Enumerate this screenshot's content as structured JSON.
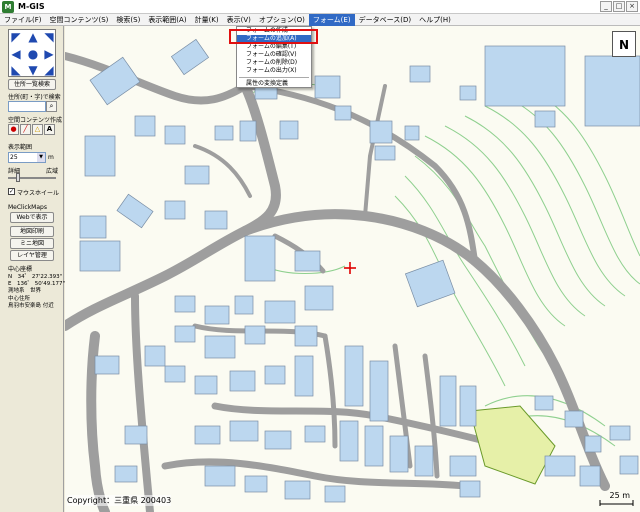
{
  "window": {
    "title": "M-GIS",
    "icon_letter": "M"
  },
  "menu": [
    "ファイル(F)",
    "空間コンテンツ(S)",
    "検索(S)",
    "表示範囲(A)",
    "計量(K)",
    "表示(V)",
    "オプション(O)",
    "フォーム(E)",
    "データベース(D)",
    "ヘルプ(H)"
  ],
  "dropdown": {
    "items": [
      "フォームの作成",
      "フォームの追加(A)",
      "フォームの編集(T)",
      "フォームの確認(V)",
      "フォームの削除(D)",
      "フォームの出力(X)"
    ],
    "extra": "属性の変換定義",
    "highlighted_index": 1
  },
  "panel": {
    "address_list_button": "住所一覧検索",
    "address_search_label": "住所(町・字)で検索",
    "spatial_create_label": "空間コンテンツ作成",
    "range_label": "表示範囲",
    "range_value": "25",
    "range_unit": "m",
    "detail_label": "詳細",
    "wide_label": "広域",
    "mouse_wheel_label": "マウスホイール",
    "meclick_label": "MeClickMaps",
    "web_button": "Webで表示",
    "print_button": "地図印刷",
    "mini_map_button": "ミニ地図",
    "layer_button": "レイヤ管理",
    "center_coord_label": "中心座標",
    "north_coord": "N　34゜ 27'22.393\"",
    "east_coord": "E　136゜ 50'49.177\"",
    "datum": "測地系　世界",
    "center_address_label": "中心住所",
    "center_address": "鳥羽市安楽島 付近"
  },
  "map": {
    "north_label": "N",
    "copyright": "Copyright：三重県 200403",
    "scale_label": "25 m"
  },
  "colors": {
    "building": "#bcd7ef",
    "road": "#9e9e9e",
    "highlight_polygon": "#e6f0a8",
    "contour": "#8fd08f",
    "menu_highlight": "#316ac5",
    "red_frame": "#e01010"
  }
}
